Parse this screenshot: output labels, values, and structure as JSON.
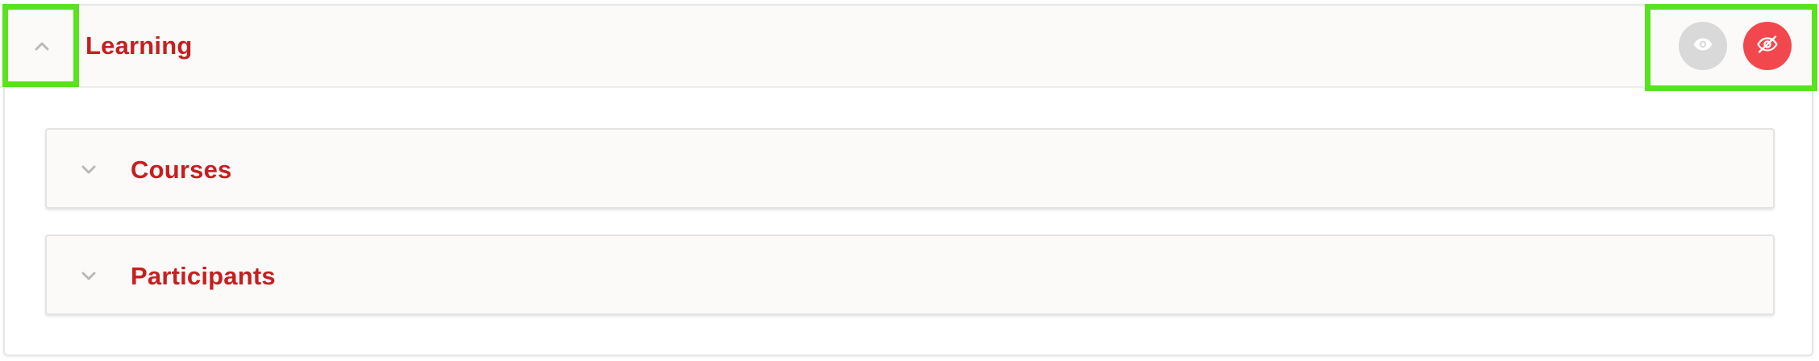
{
  "section": {
    "title": "Learning",
    "expanded": true,
    "toggle_icon": "chevron-up-icon",
    "actions": [
      {
        "name": "show",
        "icon": "eye-icon",
        "color": "#d9d9d9"
      },
      {
        "name": "hide",
        "icon": "eye-slash-icon",
        "color": "#f0484d"
      }
    ]
  },
  "subsections": [
    {
      "title": "Courses",
      "expanded": false,
      "toggle_icon": "chevron-down-icon"
    },
    {
      "title": "Participants",
      "expanded": false,
      "toggle_icon": "chevron-down-icon"
    }
  ],
  "colors": {
    "title": "#c61f1f",
    "highlight": "#57e31d",
    "header_background": "#fbfaf9"
  }
}
